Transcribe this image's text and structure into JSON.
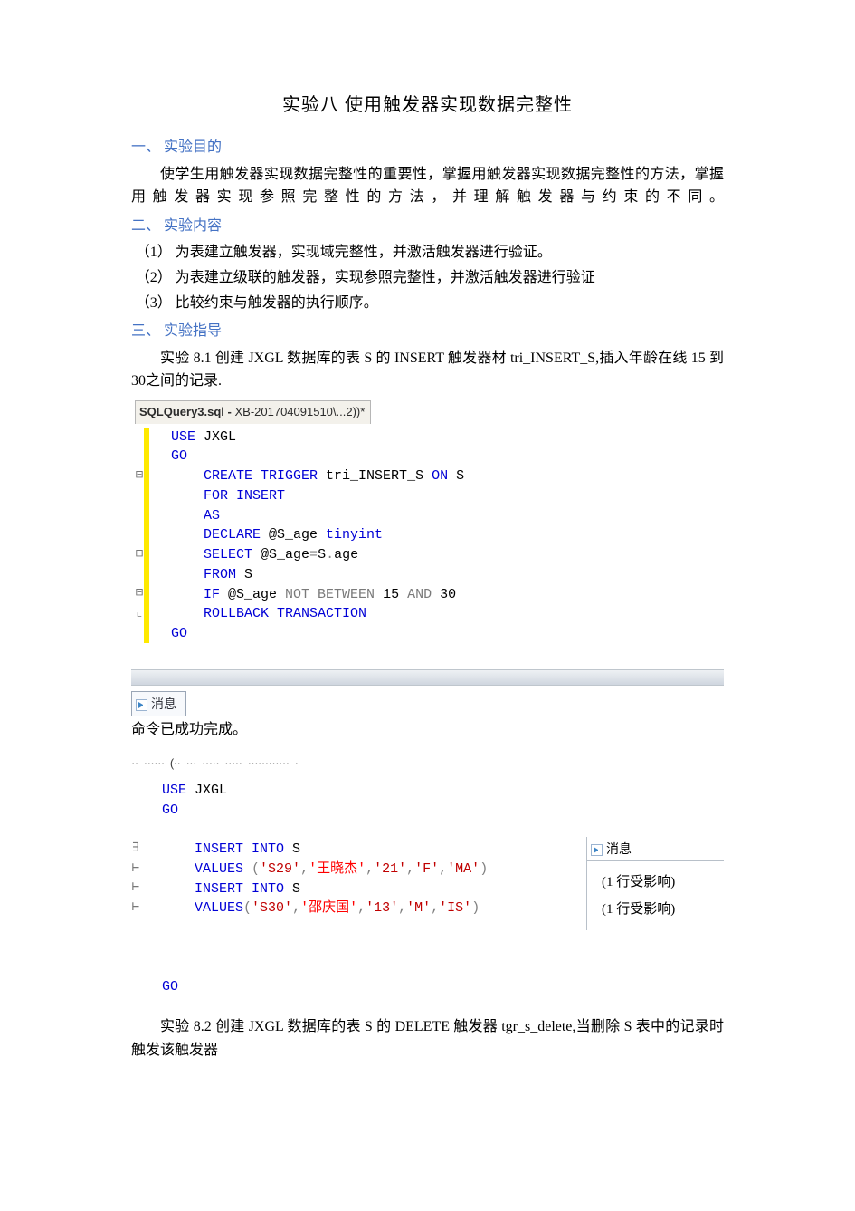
{
  "title": "实验八    使用触发器实现数据完整性",
  "section1": {
    "heading": "一、    实验目的",
    "para": "使学生用触发器实现数据完整性的重要性，掌握用触发器实现数据完整性的方法，掌握用触发器实现参照完整性的方法，并理解触发器与约束的不同。"
  },
  "section2": {
    "heading": "二、    实验内容",
    "items": [
      "（1）    为表建立触发器，实现域完整性，并激活触发器进行验证。",
      "（2）    为表建立级联的触发器，实现参照完整性，并激活触发器进行验证",
      "（3）    比较约束与触发器的执行顺序。"
    ]
  },
  "section3": {
    "heading": "三、    实验指导",
    "exp81": "实验 8.1 创建 JXGL 数据库的表 S 的 INSERT 触发器材 tri_INSERT_S,插入年龄在线 15 到 30之间的记录."
  },
  "code1": {
    "tab_bold": "SQLQuery3.sql - ",
    "tab_thin": "XB-201704091510\\...2))*",
    "lines": [
      {
        "indent": 1,
        "tokens": [
          {
            "t": "kw",
            "v": "USE "
          },
          {
            "t": "ident",
            "v": "JXGL"
          }
        ]
      },
      {
        "indent": 1,
        "tokens": [
          {
            "t": "kw",
            "v": "GO"
          }
        ]
      },
      {
        "indent": 2,
        "tokens": [
          {
            "t": "kw",
            "v": "CREATE TRIGGER"
          },
          {
            "t": "ident",
            "v": " tri_INSERT_S "
          },
          {
            "t": "kw",
            "v": "ON"
          },
          {
            "t": "ident",
            "v": " S"
          }
        ]
      },
      {
        "indent": 2,
        "tokens": [
          {
            "t": "kw",
            "v": "FOR INSERT"
          }
        ]
      },
      {
        "indent": 2,
        "tokens": [
          {
            "t": "kw",
            "v": "AS"
          }
        ]
      },
      {
        "indent": 2,
        "tokens": [
          {
            "t": "kw",
            "v": "DECLARE"
          },
          {
            "t": "ident",
            "v": " @S_age "
          },
          {
            "t": "kw",
            "v": "tinyint"
          }
        ]
      },
      {
        "indent": 2,
        "tokens": [
          {
            "t": "kw",
            "v": "SELECT"
          },
          {
            "t": "ident",
            "v": " @S_age"
          },
          {
            "t": "op",
            "v": "="
          },
          {
            "t": "ident",
            "v": "S"
          },
          {
            "t": "op",
            "v": "."
          },
          {
            "t": "ident",
            "v": "age"
          }
        ]
      },
      {
        "indent": 2,
        "tokens": [
          {
            "t": "kw",
            "v": "FROM"
          },
          {
            "t": "ident",
            "v": " S"
          }
        ]
      },
      {
        "indent": 2,
        "tokens": [
          {
            "t": "kw",
            "v": "IF"
          },
          {
            "t": "ident",
            "v": " @S_age "
          },
          {
            "t": "gray",
            "v": "NOT BETWEEN"
          },
          {
            "t": "ident",
            "v": " 15 "
          },
          {
            "t": "gray",
            "v": "AND"
          },
          {
            "t": "ident",
            "v": " 30"
          }
        ]
      },
      {
        "indent": 2,
        "tokens": [
          {
            "t": "kw",
            "v": "ROLLBACK TRANSACTION"
          }
        ]
      },
      {
        "indent": 1,
        "tokens": [
          {
            "t": "kw",
            "v": "GO"
          }
        ]
      }
    ],
    "outline": [
      "",
      "",
      "⊟",
      "",
      "",
      "",
      "⊟",
      "",
      "⊟",
      "⌞",
      ""
    ]
  },
  "msg1": {
    "tab": "消息",
    "text": "命令已成功完成。"
  },
  "garbled_header": "·· ······ (·· ··· ·····  ·····  ············  ·",
  "code2": {
    "lines": [
      {
        "indent": 1,
        "tokens": [
          {
            "t": "kw",
            "v": "USE "
          },
          {
            "t": "ident",
            "v": "JXGL"
          }
        ]
      },
      {
        "indent": 1,
        "tokens": [
          {
            "t": "kw",
            "v": "GO"
          }
        ]
      },
      {
        "indent": 0,
        "tokens": []
      },
      {
        "indent": 2,
        "tokens": [
          {
            "t": "kw",
            "v": "INSERT INTO"
          },
          {
            "t": "ident",
            "v": " S"
          }
        ]
      },
      {
        "indent": 2,
        "tokens": [
          {
            "t": "kw",
            "v": "VALUES "
          },
          {
            "t": "op",
            "v": "("
          },
          {
            "t": "str",
            "v": "'S29'"
          },
          {
            "t": "op",
            "v": ","
          },
          {
            "t": "cn-str",
            "v": "'王晓杰'"
          },
          {
            "t": "op",
            "v": ","
          },
          {
            "t": "str",
            "v": "'21'"
          },
          {
            "t": "op",
            "v": ","
          },
          {
            "t": "str",
            "v": "'F'"
          },
          {
            "t": "op",
            "v": ","
          },
          {
            "t": "str",
            "v": "'MA'"
          },
          {
            "t": "op",
            "v": ")"
          }
        ]
      },
      {
        "indent": 2,
        "tokens": [
          {
            "t": "kw",
            "v": "INSERT INTO"
          },
          {
            "t": "ident",
            "v": " S"
          }
        ]
      },
      {
        "indent": 2,
        "tokens": [
          {
            "t": "kw",
            "v": "VALUES"
          },
          {
            "t": "op",
            "v": "("
          },
          {
            "t": "str",
            "v": "'S30'"
          },
          {
            "t": "op",
            "v": ","
          },
          {
            "t": "cn-str",
            "v": "'邵庆国'"
          },
          {
            "t": "op",
            "v": ","
          },
          {
            "t": "str",
            "v": "'13'"
          },
          {
            "t": "op",
            "v": ","
          },
          {
            "t": "str",
            "v": "'M'"
          },
          {
            "t": "op",
            "v": ","
          },
          {
            "t": "str",
            "v": "'IS'"
          },
          {
            "t": "op",
            "v": ")"
          }
        ]
      },
      {
        "indent": 0,
        "tokens": []
      },
      {
        "indent": 0,
        "tokens": []
      },
      {
        "indent": 0,
        "tokens": []
      },
      {
        "indent": 1,
        "tokens": [
          {
            "t": "kw",
            "v": "GO"
          }
        ]
      }
    ],
    "outline": [
      "",
      "",
      "",
      "∃",
      "⊢",
      "⊢",
      "⊢",
      "",
      "",
      "",
      "",
      ""
    ]
  },
  "msg2": {
    "tab": "消息",
    "line1": "(1 行受影响)",
    "line2": "(1 行受影响)"
  },
  "exp82": "实验 8.2    创建 JXGL    数据库的表 S  的 DELETE  触发器 tgr_s_delete,当删除 S 表中的记录时触发该触发器"
}
